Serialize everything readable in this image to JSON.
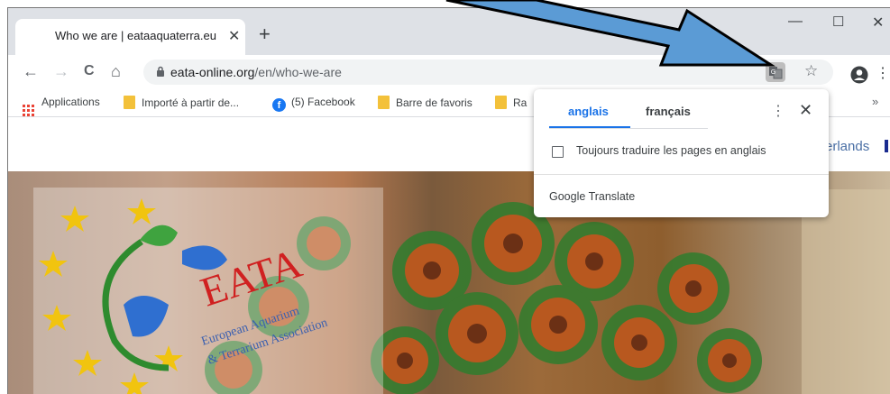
{
  "tab": {
    "title": "Who we are | eataaquaterra.eu",
    "close": "✕",
    "new_tab": "+"
  },
  "window": {
    "minimize": "—",
    "maximize": "☐",
    "close": "✕"
  },
  "nav": {
    "back": "←",
    "forward": "→",
    "reload": "C",
    "home": "⌂"
  },
  "address": {
    "domain": "eata-online.org",
    "path": "/en/who-we-are"
  },
  "toolbar": {
    "star": "☆",
    "menu": "⋮"
  },
  "bookmarks": {
    "items": [
      "Applications",
      "Importé à partir de...",
      "(5) Facebook",
      "Barre de favoris",
      "Ra"
    ],
    "overflow": "»"
  },
  "page": {
    "language_link": "erlands"
  },
  "logo": {
    "title": "EATA",
    "line1": "European Aquarium",
    "line2": "& Terrarium Association"
  },
  "translate": {
    "tab_source": "anglais",
    "tab_target": "français",
    "more": "⋮",
    "close": "✕",
    "always_translate": "Toujours traduire les pages en anglais",
    "brand_google": "Google",
    "brand_translate": "Translate"
  },
  "colors": {
    "accent": "#1a73e8",
    "arrow": "#5b9bd5",
    "bookmark_folder": "#f3c13a",
    "facebook": "#1877f2"
  }
}
